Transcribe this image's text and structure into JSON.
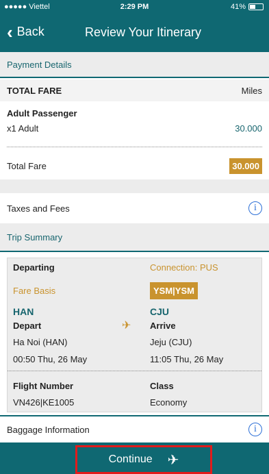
{
  "status_bar": {
    "carrier": "●●●●● Viettel",
    "time": "2:29 PM",
    "battery": "41%"
  },
  "nav": {
    "back_label": "Back",
    "title": "Review Your Itinerary"
  },
  "payment": {
    "section_title": "Payment Details",
    "total_fare_header": "TOTAL FARE",
    "unit_label": "Miles",
    "passenger_type": "Adult Passenger",
    "passenger_count": "x1 Adult",
    "passenger_amount": "30.000",
    "total_fare_label": "Total Fare",
    "total_fare_value": "30.000",
    "taxes_label": "Taxes and Fees"
  },
  "trip": {
    "section_title": "Trip Summary",
    "departing_label": "Departing",
    "connection": "Connection: PUS",
    "fare_basis_label": "Fare Basis",
    "fare_basis_value": "YSM|YSM",
    "origin_code": "HAN",
    "dest_code": "CJU",
    "depart_label": "Depart",
    "arrive_label": "Arrive",
    "origin_name": "Ha Noi (HAN)",
    "dest_name": "Jeju (CJU)",
    "depart_time": "00:50 Thu, 26 May",
    "arrive_time": "11:05 Thu, 26 May",
    "flight_number_label": "Flight Number",
    "flight_number": "VN426|KE1005",
    "class_label": "Class",
    "class_value": "Economy"
  },
  "baggage": {
    "label": "Baggage Information"
  },
  "footer": {
    "continue_label": "Continue"
  },
  "colors": {
    "primary": "#0f6872",
    "gold": "#c9932e",
    "highlight": "#e21b1b"
  },
  "icons": [
    "back-chevron-icon",
    "info-icon",
    "airplane-icon",
    "battery-icon",
    "wifi-icon"
  ]
}
